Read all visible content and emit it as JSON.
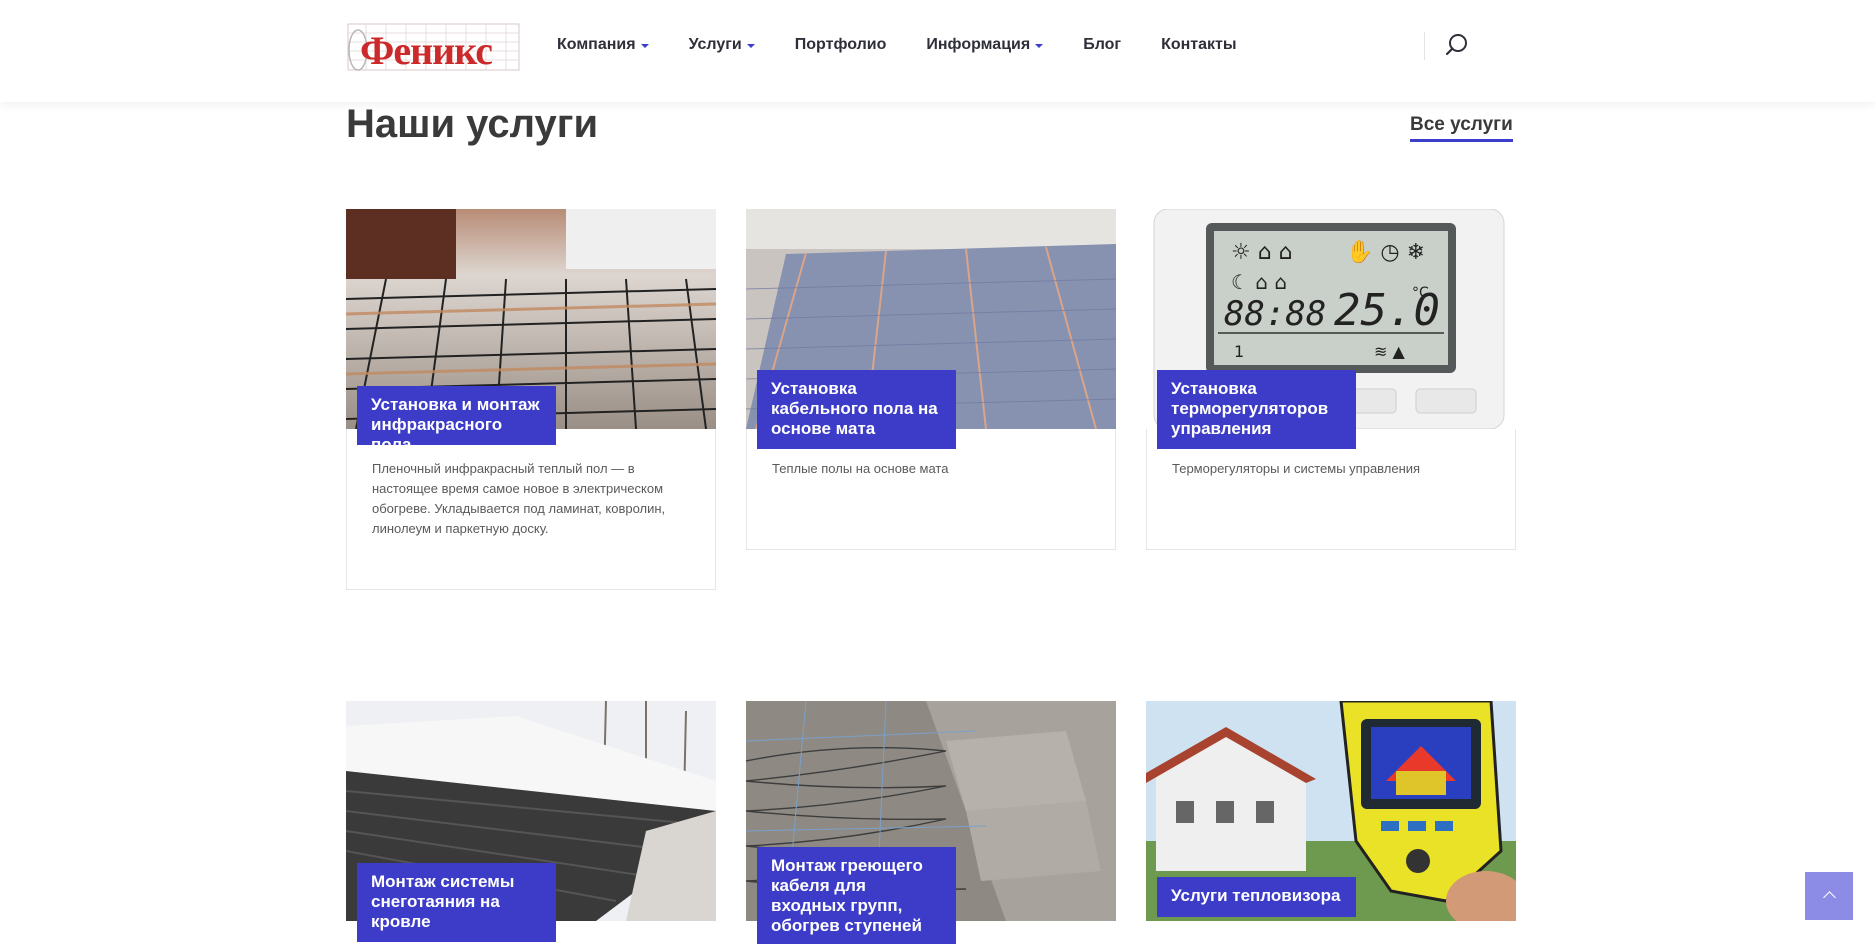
{
  "header": {
    "logo_text": "Феникс",
    "nav": [
      {
        "label": "Компания",
        "dropdown": true
      },
      {
        "label": "Услуги",
        "dropdown": true
      },
      {
        "label": "Портфолио",
        "dropdown": false
      },
      {
        "label": "Информация",
        "dropdown": true
      },
      {
        "label": "Блог",
        "dropdown": false
      },
      {
        "label": "Контакты",
        "dropdown": false
      }
    ],
    "search_icon": "search-icon"
  },
  "section": {
    "title": "Наши услуги",
    "all_link": "Все услуги"
  },
  "services": [
    {
      "label": "Установка и монтаж инфракрасного пола",
      "description": "Пленочный инфракрасный теплый пол — в настоящее время самое новое в электрическом обогреве. Укладывается под ламинат, ковролин, линолеум и паркетную доску.",
      "image": "infrared-floor-film"
    },
    {
      "label": "Установка кабельного пола на основе мата",
      "description": "Теплые полы на основе мата",
      "image": "cable-heating-mat"
    },
    {
      "label": "Установка терморегуляторов управления",
      "description": "Терморегуляторы и системы управления",
      "image": "thermostat-display"
    },
    {
      "label": "Монтаж системы снеготаяния на кровле",
      "description": "",
      "image": "roof-snow-melting"
    },
    {
      "label": "Монтаж греющего кабеля для входных групп, обогрев ступеней",
      "description": "",
      "image": "heated-steps-cable"
    },
    {
      "label": "Услуги тепловизора",
      "description": "",
      "image": "thermal-imager"
    }
  ],
  "thermostat": {
    "small_display": "88:88",
    "temperature": "25.0",
    "unit": "°C",
    "program": "1"
  },
  "colors": {
    "accent": "#3c3cc8",
    "title": "#3a3a3a",
    "totop": "#8c8ce6"
  }
}
